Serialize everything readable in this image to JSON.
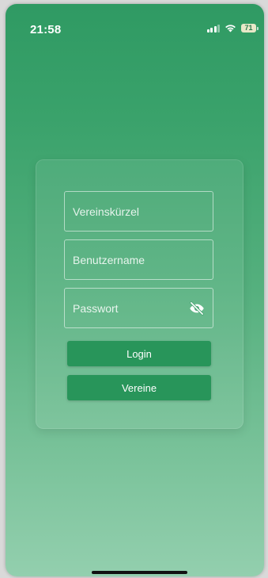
{
  "status_bar": {
    "time": "21:58",
    "battery_level": "71",
    "icons": [
      "signal-icon",
      "wifi-icon",
      "battery-icon"
    ]
  },
  "login_form": {
    "club_code_placeholder": "Vereinskürzel",
    "username_placeholder": "Benutzername",
    "password_placeholder": "Passwort",
    "password_toggle_icon": "eye-slash-icon",
    "login_label": "Login",
    "clubs_label": "Vereine"
  },
  "colors": {
    "gradient_top": "#2f9a63",
    "gradient_bottom": "#93cfae",
    "button": "#28955a",
    "text": "#ffffff"
  }
}
